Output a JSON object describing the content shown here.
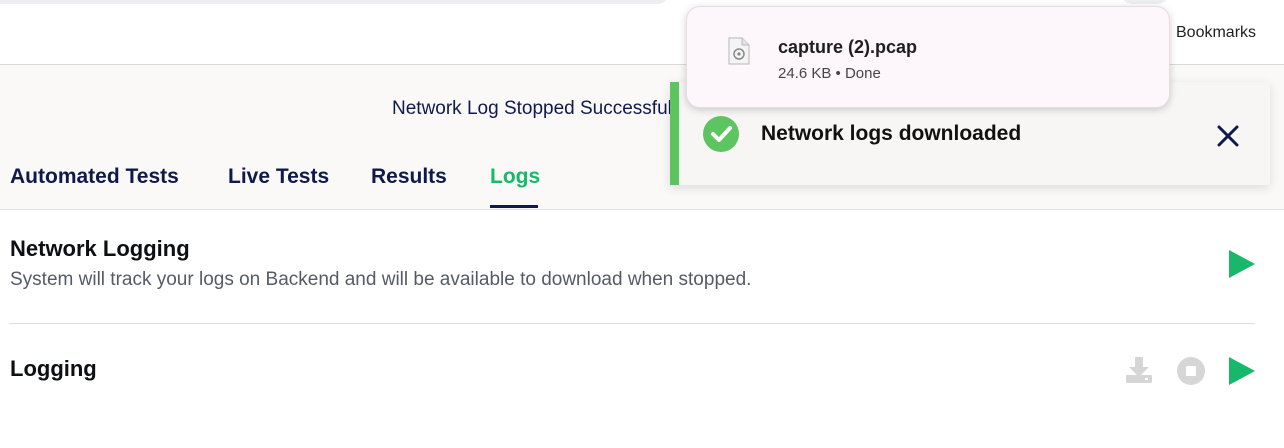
{
  "browser": {
    "bookmarks_label": "Bookmarks"
  },
  "download": {
    "file_name": "capture (2).pcap",
    "file_meta": "24.6 KB • Done"
  },
  "toast": {
    "message": "Network logs downloaded",
    "accent_color": "#5cc55f"
  },
  "status": {
    "text": "Network Log Stopped Successfully"
  },
  "tabs": [
    {
      "label": "Automated Tests"
    },
    {
      "label": "Live Tests"
    },
    {
      "label": "Results"
    },
    {
      "label": "Logs",
      "active": true
    }
  ],
  "network_logging": {
    "title": "Network Logging",
    "description": "System will track your logs on Backend and will be available to download when stopped."
  },
  "logging": {
    "title": "Logging"
  },
  "colors": {
    "accent_green": "#17b86a",
    "navy": "#0f1a4a",
    "disabled_gray": "#d6d6d6"
  },
  "icons": {
    "file": "document-file-icon",
    "check": "check-circle-icon",
    "close": "close-icon",
    "play": "play-icon",
    "download": "download-icon",
    "stop": "stop-icon"
  }
}
